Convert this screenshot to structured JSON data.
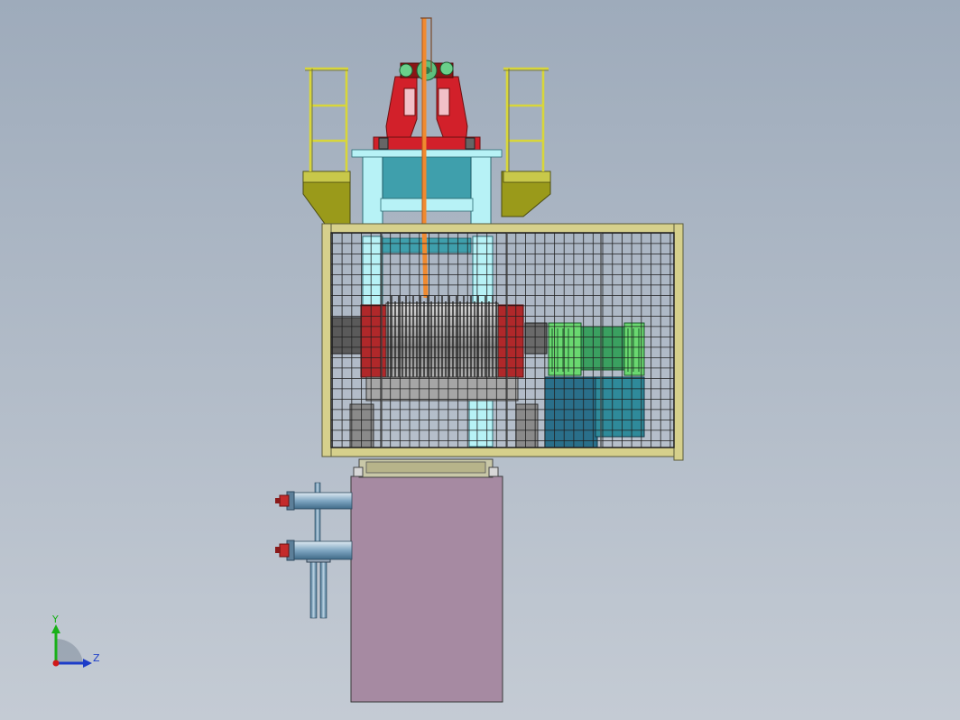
{
  "viewport": {
    "background_top": "#9eabbb",
    "background_bottom": "#c4cbd4"
  },
  "triad": {
    "y_label": "Y",
    "z_label": "Z",
    "y_color": "#18b018",
    "z_color": "#1c3cc8",
    "origin_color": "#d01818"
  },
  "model": {
    "colors": {
      "railing": "#d8d63a",
      "platform": "#9a9a1a",
      "sheave_frame": "#d2202a",
      "pulley": "#6ad08a",
      "cable": "#f08a30",
      "light_cyan": "#b7f2f6",
      "teal": "#3f9fac",
      "cage_frame": "#d6d08c",
      "cage_mesh": "#222222",
      "drum": "#9a9a9a",
      "drum_flange": "#b0282a",
      "motor": "#6ad870",
      "motor_base": "#2f8a9a",
      "pedestal": "#a68aa2",
      "pipe": "#7fa6c2",
      "valve": "#c42b2b"
    }
  }
}
